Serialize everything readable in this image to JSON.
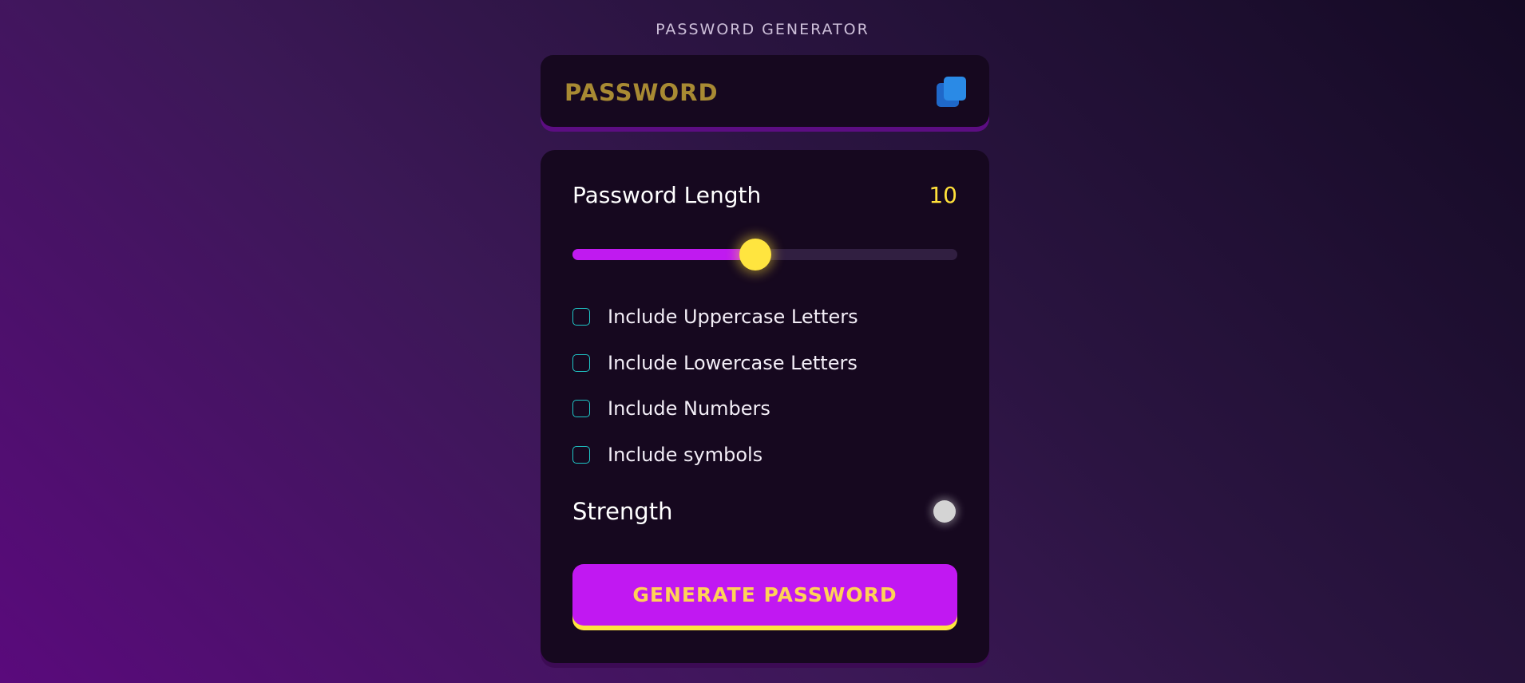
{
  "app": {
    "title": "PASSWORD GENERATOR"
  },
  "display": {
    "password_text": "PASSWORD",
    "copy_icon": "copy-icon"
  },
  "length": {
    "label": "Password Length",
    "value": "10",
    "slider_fraction": 0.475
  },
  "options": [
    {
      "label": "Include Uppercase Letters",
      "checked": false
    },
    {
      "label": "Include Lowercase Letters",
      "checked": false
    },
    {
      "label": "Include Numbers",
      "checked": false
    },
    {
      "label": "Include symbols",
      "checked": false
    }
  ],
  "strength": {
    "label": "Strength",
    "indicator_color": "#d4d4d4"
  },
  "generate": {
    "label": "GENERATE PASSWORD"
  },
  "colors": {
    "accent_purple": "#c118f2",
    "accent_yellow": "#ffe53f",
    "checkbox_border": "#1fc7c7",
    "password_text": "#a88a33",
    "copy_icon": "#2a8ae6"
  }
}
